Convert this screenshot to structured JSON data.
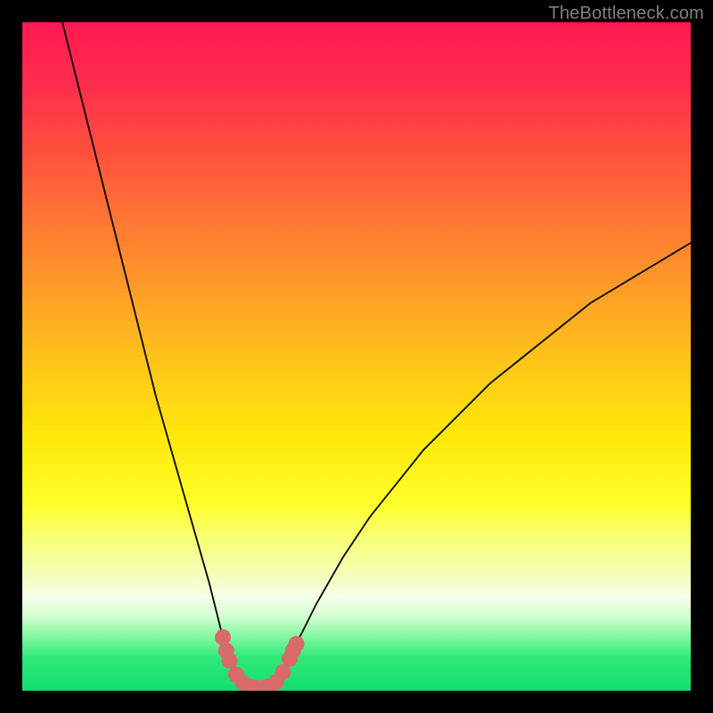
{
  "watermark": "TheBottleneck.com",
  "chart_data": {
    "type": "line",
    "title": "",
    "xlabel": "",
    "ylabel": "",
    "xlim": [
      0,
      100
    ],
    "ylim": [
      0,
      100
    ],
    "background_gradient": {
      "stops": [
        {
          "offset": 0,
          "color": "#ff1a52"
        },
        {
          "offset": 10,
          "color": "#ff2e4a"
        },
        {
          "offset": 22,
          "color": "#ff5a3a"
        },
        {
          "offset": 35,
          "color": "#ff8a2e"
        },
        {
          "offset": 50,
          "color": "#ffc21a"
        },
        {
          "offset": 62,
          "color": "#ffe80a"
        },
        {
          "offset": 72,
          "color": "#ffff2a"
        },
        {
          "offset": 78,
          "color": "#f8ff80"
        },
        {
          "offset": 83,
          "color": "#f4ffc0"
        },
        {
          "offset": 86,
          "color": "#f6ffe8"
        },
        {
          "offset": 89,
          "color": "#d0ffd0"
        },
        {
          "offset": 92,
          "color": "#80f8a0"
        },
        {
          "offset": 95,
          "color": "#30e878"
        },
        {
          "offset": 100,
          "color": "#10e070"
        }
      ]
    },
    "series": [
      {
        "name": "bottleneck-curve",
        "color": "#000000",
        "width": 1.8,
        "points": [
          {
            "x": 6,
            "y": 100
          },
          {
            "x": 8,
            "y": 92
          },
          {
            "x": 10,
            "y": 84
          },
          {
            "x": 12,
            "y": 76
          },
          {
            "x": 14,
            "y": 68
          },
          {
            "x": 16,
            "y": 60
          },
          {
            "x": 18,
            "y": 52
          },
          {
            "x": 20,
            "y": 44
          },
          {
            "x": 22,
            "y": 37
          },
          {
            "x": 24,
            "y": 30
          },
          {
            "x": 26,
            "y": 23
          },
          {
            "x": 28,
            "y": 16
          },
          {
            "x": 29,
            "y": 12
          },
          {
            "x": 30,
            "y": 8
          },
          {
            "x": 31,
            "y": 5
          },
          {
            "x": 32,
            "y": 3
          },
          {
            "x": 33,
            "y": 1.5
          },
          {
            "x": 34,
            "y": 0.6
          },
          {
            "x": 35,
            "y": 0.2
          },
          {
            "x": 36,
            "y": 0.2
          },
          {
            "x": 37,
            "y": 0.6
          },
          {
            "x": 38,
            "y": 1.5
          },
          {
            "x": 39,
            "y": 3
          },
          {
            "x": 40,
            "y": 5
          },
          {
            "x": 42,
            "y": 9
          },
          {
            "x": 44,
            "y": 13
          },
          {
            "x": 48,
            "y": 20
          },
          {
            "x": 52,
            "y": 26
          },
          {
            "x": 56,
            "y": 31
          },
          {
            "x": 60,
            "y": 36
          },
          {
            "x": 65,
            "y": 41
          },
          {
            "x": 70,
            "y": 46
          },
          {
            "x": 75,
            "y": 50
          },
          {
            "x": 80,
            "y": 54
          },
          {
            "x": 85,
            "y": 58
          },
          {
            "x": 90,
            "y": 61
          },
          {
            "x": 95,
            "y": 64
          },
          {
            "x": 100,
            "y": 67
          }
        ]
      }
    ],
    "markers": {
      "name": "sweet-spot",
      "color": "#d96a6a",
      "radius": 9,
      "points": [
        {
          "x": 30.0,
          "y": 8.0
        },
        {
          "x": 30.5,
          "y": 6.0
        },
        {
          "x": 31.0,
          "y": 4.5
        },
        {
          "x": 32.0,
          "y": 2.4
        },
        {
          "x": 33.0,
          "y": 1.2
        },
        {
          "x": 34.0,
          "y": 0.6
        },
        {
          "x": 35.0,
          "y": 0.4
        },
        {
          "x": 36.0,
          "y": 0.4
        },
        {
          "x": 37.0,
          "y": 0.7
        },
        {
          "x": 38.0,
          "y": 1.3
        },
        {
          "x": 39.0,
          "y": 2.8
        },
        {
          "x": 40.0,
          "y": 4.8
        },
        {
          "x": 40.5,
          "y": 6.0
        },
        {
          "x": 41.0,
          "y": 7.0
        }
      ]
    }
  }
}
